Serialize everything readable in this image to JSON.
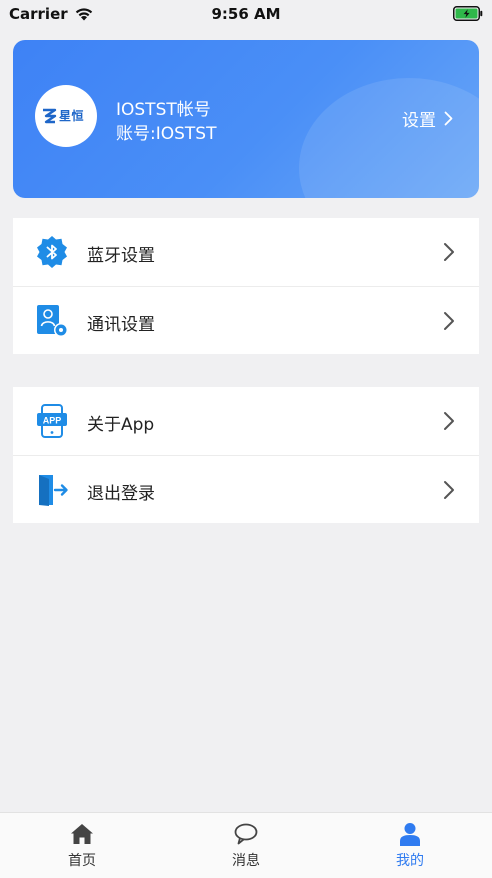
{
  "status_bar": {
    "carrier": "Carrier",
    "time": "9:56 AM"
  },
  "profile": {
    "logo_text": "星恒",
    "account_title": "IOSTST帐号",
    "account_id": "账号:IOSTST",
    "settings_label": "设置"
  },
  "menu_groups": [
    {
      "items": [
        {
          "label": "蓝牙设置",
          "icon": "bluetooth-gear-icon"
        },
        {
          "label": "通讯设置",
          "icon": "user-settings-icon"
        }
      ]
    },
    {
      "items": [
        {
          "label": "关于App",
          "icon": "app-phone-icon"
        },
        {
          "label": "退出登录",
          "icon": "logout-door-icon"
        }
      ]
    }
  ],
  "tab_bar": {
    "tabs": [
      {
        "label": "首页",
        "icon": "home-icon",
        "active": false
      },
      {
        "label": "消息",
        "icon": "chat-bubble-icon",
        "active": false
      },
      {
        "label": "我的",
        "icon": "profile-icon",
        "active": true
      }
    ]
  },
  "colors": {
    "accent": "#2f7bf0",
    "card_start": "#3e82f5",
    "card_end": "#6aa7f7",
    "background": "#f0f0f2",
    "battery": "#2fb84a"
  }
}
